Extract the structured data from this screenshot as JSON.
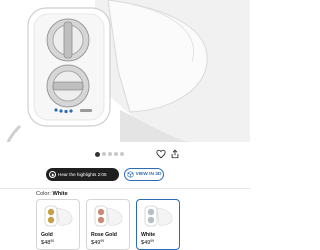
{
  "product_image": {
    "alt": "white bidet attachment with two chrome dials mounted on a toilet bowl"
  },
  "carousel": {
    "count": 5,
    "active": 0
  },
  "actions": {
    "wishlist_icon": "heart-icon",
    "share_icon": "share-icon"
  },
  "video_button": {
    "label": "Hear the highlights 2:05",
    "icon": "play-icon"
  },
  "view3d_button": {
    "label": "VIEW IN 3D",
    "icon": "cube-icon"
  },
  "color": {
    "label": "Color:",
    "value": "White"
  },
  "variants": [
    {
      "name": "Gold",
      "price_whole": "$48",
      "price_frac": "90",
      "tone": "#c9a04a"
    },
    {
      "name": "Rose Gold",
      "price_whole": "$49",
      "price_frac": "99",
      "tone": "#c98a7a"
    },
    {
      "name": "White",
      "price_whole": "$49",
      "price_frac": "99",
      "tone": "#b9bec4"
    }
  ],
  "colors": {
    "accent": "#2a6db5",
    "pill_dark": "#1f1f1f"
  }
}
